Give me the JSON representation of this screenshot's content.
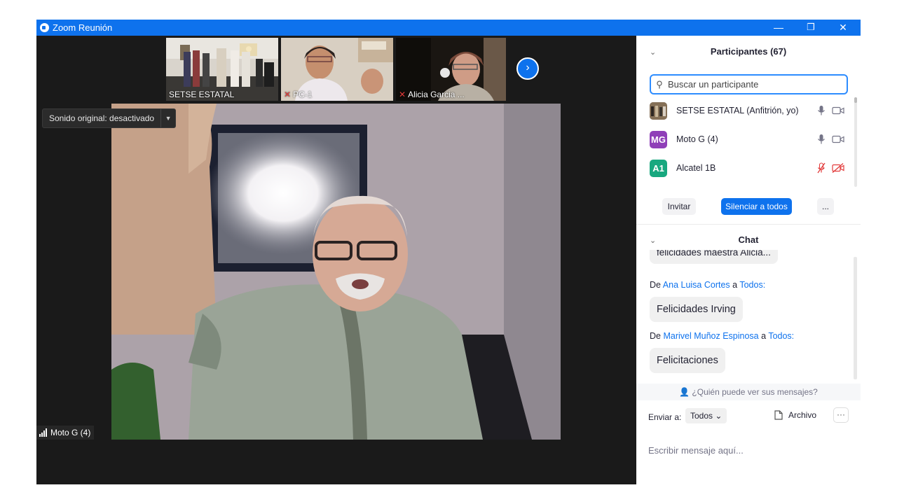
{
  "window": {
    "title": "Zoom Reunión",
    "minimize": "—",
    "restore": "❐",
    "close": "✕"
  },
  "thumbnails": [
    {
      "label": "SETSE ESTATAL",
      "muted": false
    },
    {
      "label": "PC-1",
      "muted": true
    },
    {
      "label": "Alicia Garcia ...",
      "muted": true
    }
  ],
  "main_video": {
    "sound_pill": "Sonido original: desactivado",
    "speaker_name": "Moto G (4)"
  },
  "participants": {
    "header": "Participantes (67)",
    "search_placeholder": "Buscar un participante",
    "items": [
      {
        "name": "SETSE ESTATAL (Anfitrión, yo)",
        "avatar": "",
        "avatar_color": "#6b5a4a",
        "mic_muted": false,
        "video_off": false
      },
      {
        "name": "Moto G (4)",
        "avatar": "MG",
        "avatar_color": "#8f3fb8",
        "mic_muted": false,
        "video_off": false
      },
      {
        "name": "Alcatel 1B",
        "avatar": "A1",
        "avatar_color": "#18a87f",
        "mic_muted": true,
        "video_off": true
      }
    ],
    "buttons": {
      "invite": "Invitar",
      "mute_all": "Silenciar a todos",
      "more": "..."
    }
  },
  "chat": {
    "header": "Chat",
    "messages": [
      {
        "from_prefix": "",
        "sender": "",
        "to_word": "",
        "recipient": "",
        "text": "felicidades maestra Alicia..."
      },
      {
        "from_prefix": "De",
        "sender": "Ana Luisa Cortes",
        "to_word": "a",
        "recipient": "Todos:",
        "text": "Felicidades Irving"
      },
      {
        "from_prefix": "De",
        "sender": "Marivel Muñoz Espinosa",
        "to_word": "a",
        "recipient": "Todos:",
        "text": "Felicitaciones"
      }
    ],
    "who_can_see": "¿Quién puede ver sus mensajes?",
    "send_to_label": "Enviar a:",
    "send_to_value": "Todos",
    "file_label": "Archivo",
    "more": "···",
    "input_placeholder": "Escribir mensaje aquí..."
  },
  "colors": {
    "zoom_blue": "#0e72ed",
    "muted_red": "#e23b3b",
    "link_blue": "#0e72ed"
  }
}
